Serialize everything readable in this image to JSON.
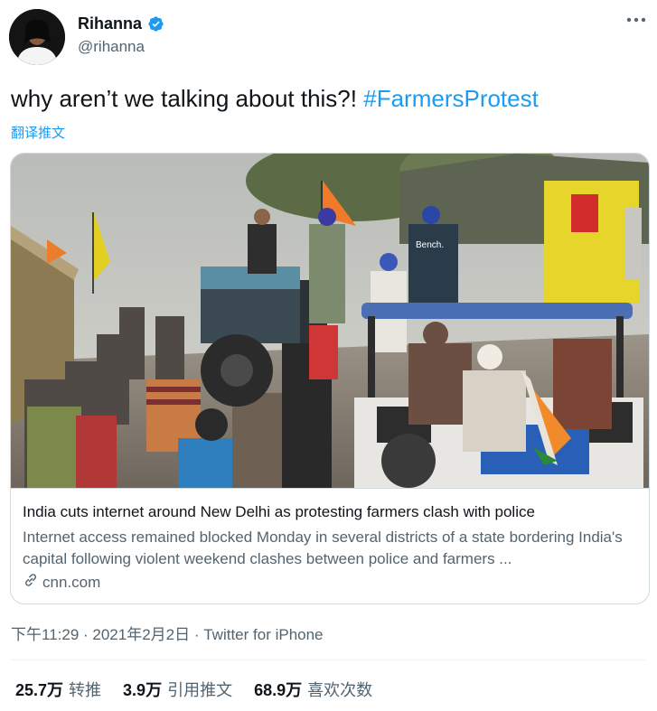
{
  "author": {
    "name": "Rihanna",
    "handle": "@rihanna"
  },
  "tweet": {
    "text": "why aren’t we talking about this?!",
    "hashtag": "#FarmersProtest",
    "translate_label": "翻译推文"
  },
  "card": {
    "title": "India cuts internet around New Delhi as protesting farmers clash with police",
    "description": "Internet access remained blocked Monday in several districts of a state bordering India's capital following violent weekend clashes between police and farmers ...",
    "domain": "cnn.com",
    "image_sign_text": "Bench."
  },
  "meta": {
    "time": "下午11:29",
    "date": "2021年2月2日",
    "source": "Twitter for iPhone",
    "separator": " · "
  },
  "stats": {
    "retweets_count": "25.7万",
    "retweets_label": "转推",
    "quotes_count": "3.9万",
    "quotes_label": "引用推文",
    "likes_count": "68.9万",
    "likes_label": "喜欢次数"
  },
  "colors": {
    "accent": "#1d9bf0",
    "text_primary": "#0f1419",
    "text_secondary": "#536471",
    "border": "#cfd9de"
  },
  "icons": [
    "verified-badge-icon",
    "more-options-icon",
    "link-icon"
  ]
}
